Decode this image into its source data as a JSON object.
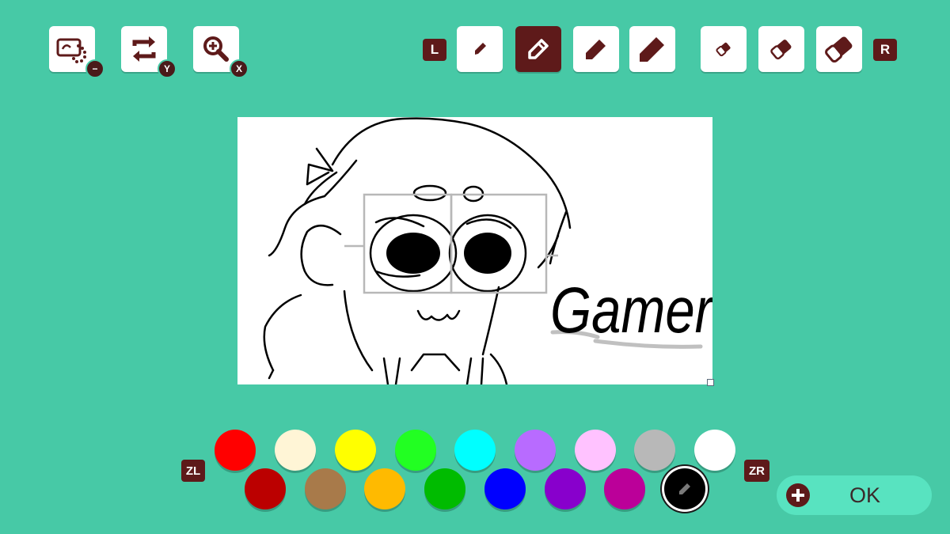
{
  "toolbar": {
    "left": [
      {
        "name": "clear-canvas-button",
        "icon": "clear-canvas-icon",
        "badge": "−"
      },
      {
        "name": "flip-button",
        "icon": "swap-arrows-icon",
        "badge": "Y"
      },
      {
        "name": "zoom-button",
        "icon": "zoom-in-icon",
        "badge": "X"
      }
    ],
    "shoulder_left": "L",
    "shoulder_right": "R",
    "pens": [
      {
        "size": "small",
        "selected": false
      },
      {
        "size": "medium",
        "selected": true
      },
      {
        "size": "large",
        "selected": false
      },
      {
        "size": "extra-large",
        "selected": false
      }
    ],
    "erasers": [
      {
        "size": "small"
      },
      {
        "size": "medium"
      },
      {
        "size": "large"
      }
    ]
  },
  "canvas": {
    "drawing_text": "Gamer"
  },
  "palette": {
    "trigger_left": "ZL",
    "trigger_right": "ZR",
    "row1": [
      "#ff0000",
      "#fff5d6",
      "#ffff00",
      "#22ff22",
      "#00ffff",
      "#b86bff",
      "#ffc2ff",
      "#b8b8b8",
      "#ffffff"
    ],
    "row2": [
      "#bb0000",
      "#a87a4a",
      "#ffba00",
      "#00bb00",
      "#0000ff",
      "#8800cc",
      "#bb0099",
      "#000000"
    ],
    "selected_color": "#000000"
  },
  "ok_label": "OK",
  "colors": {
    "background": "#47c9a6",
    "accent_dark": "#5e1a1a",
    "ok_button": "#58e3c0"
  }
}
